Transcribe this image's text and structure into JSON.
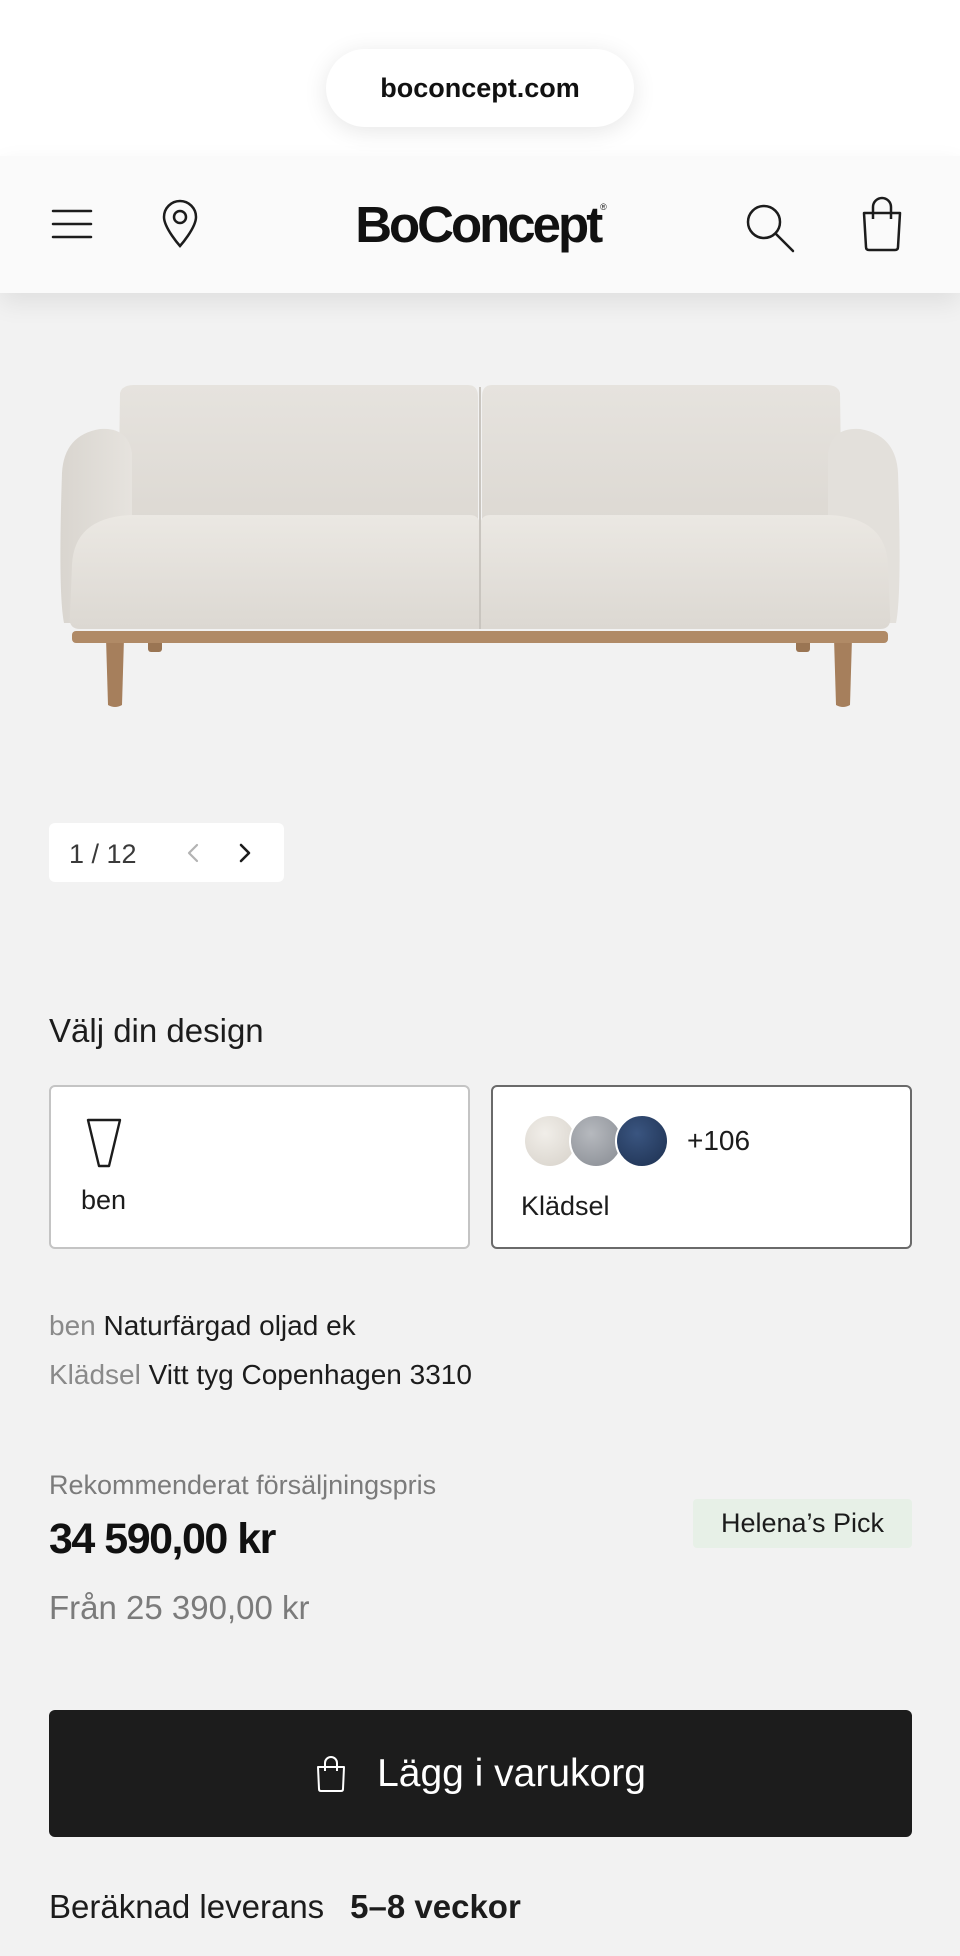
{
  "browser": {
    "url": "boconcept.com"
  },
  "header": {
    "brand": "BoConcept",
    "registered_mark": "®"
  },
  "gallery": {
    "current": 1,
    "total": 12,
    "counter_text": "1 / 12"
  },
  "design": {
    "title": "Välj din design",
    "legs_label": "ben",
    "fabric_label": "Klädsel",
    "swatches": [
      "#e3ded6",
      "#9a9ea5",
      "#233a5e"
    ],
    "more_count": "+106"
  },
  "spec": {
    "legs_key": "ben",
    "legs_value": "Naturfärgad oljad ek",
    "fabric_key": "Klädsel",
    "fabric_value": "Vitt tyg Copenhagen 3310"
  },
  "pricing": {
    "rrp_label": "Rekommenderat försäljningspris",
    "price": "34 590,00 kr",
    "from": "Från 25 390,00 kr",
    "badge": "Helena’s Pick"
  },
  "cart": {
    "label": "Lägg i varukorg"
  },
  "delivery": {
    "label": "Beräknad leverans",
    "value": "5–8 veckor"
  },
  "colors": {
    "button": "#1c1c1c",
    "page_bg": "#f2f2f2",
    "badge_bg": "#e7f0e7"
  },
  "icons": [
    "menu-icon",
    "location-pin-icon",
    "search-icon",
    "shopping-bag-icon",
    "chevron-left-icon",
    "chevron-right-icon",
    "sofa-leg-icon"
  ]
}
